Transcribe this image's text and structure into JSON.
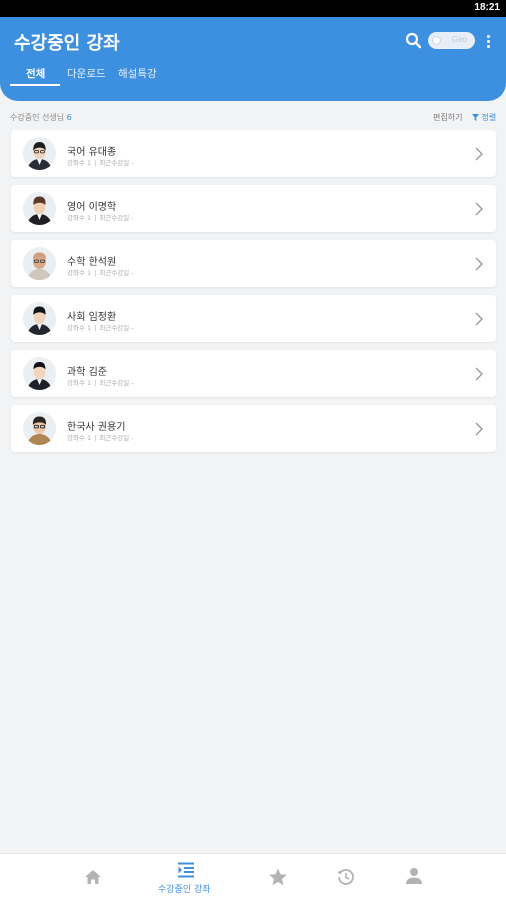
{
  "status_bar": {
    "time": "18:21"
  },
  "header": {
    "title": "수강중인 강좌",
    "toggle_label": "Geo",
    "tabs": [
      {
        "label": "전체"
      },
      {
        "label": "다운로드"
      },
      {
        "label": "해설특강"
      }
    ]
  },
  "summary": {
    "label": "수강중인 선생님",
    "count": "6",
    "edit_label": "편집하기",
    "sort_label": "정렬"
  },
  "courses": [
    {
      "subject": "국어",
      "teacher": "유대종",
      "meta1": "강좌수 1",
      "meta2": "최근수강일 -"
    },
    {
      "subject": "영어",
      "teacher": "이명학",
      "meta1": "강좌수 1",
      "meta2": "최근수강일 -"
    },
    {
      "subject": "수학",
      "teacher": "한석원",
      "meta1": "강좌수 1",
      "meta2": "최근수강일 -"
    },
    {
      "subject": "사회",
      "teacher": "임정환",
      "meta1": "강좌수 1",
      "meta2": "최근수강일 -"
    },
    {
      "subject": "과학",
      "teacher": "김준",
      "meta1": "강좌수 1",
      "meta2": "최근수강일 -"
    },
    {
      "subject": "한국사",
      "teacher": "권용기",
      "meta1": "강좌수 1",
      "meta2": "최근수강일 -"
    }
  ],
  "bottom_nav": [
    {
      "icon": "home-icon",
      "label": ""
    },
    {
      "icon": "course-list-icon",
      "label": "수강중인 강좌"
    },
    {
      "icon": "star-icon",
      "label": ""
    },
    {
      "icon": "history-icon",
      "label": ""
    },
    {
      "icon": "person-icon",
      "label": ""
    }
  ],
  "colors": {
    "accent": "#3d8fe0",
    "background": "#f2f3f5",
    "card": "#ffffff"
  }
}
